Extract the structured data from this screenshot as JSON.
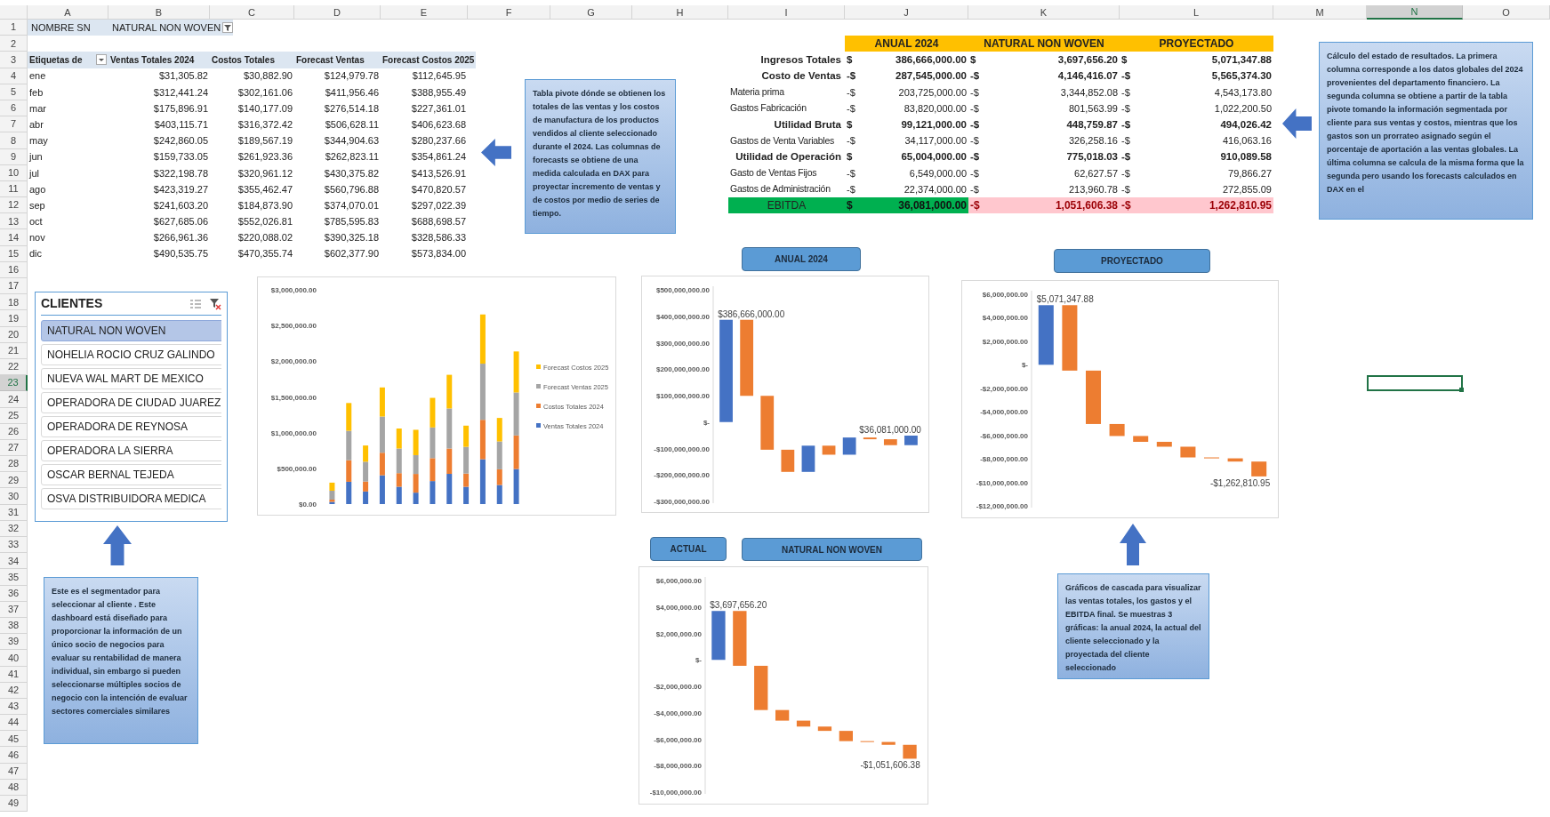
{
  "sheet": {
    "columns": [
      {
        "label": "A",
        "selected": false
      },
      {
        "label": "B",
        "selected": false
      },
      {
        "label": "C",
        "selected": false
      },
      {
        "label": "D",
        "selected": false
      },
      {
        "label": "E",
        "selected": false
      },
      {
        "label": "F",
        "selected": false
      },
      {
        "label": "G",
        "selected": false
      },
      {
        "label": "H",
        "selected": false
      },
      {
        "label": "I",
        "selected": false
      },
      {
        "label": "J",
        "selected": false
      },
      {
        "label": "K",
        "selected": false
      },
      {
        "label": "L",
        "selected": false
      },
      {
        "label": "M",
        "selected": false
      },
      {
        "label": "N",
        "selected": true
      },
      {
        "label": "O",
        "selected": false
      }
    ],
    "rows": [
      {
        "label": "1",
        "selected": false
      },
      {
        "label": "2",
        "selected": false
      },
      {
        "label": "3",
        "selected": false
      },
      {
        "label": "4",
        "selected": false
      },
      {
        "label": "5",
        "selected": false
      },
      {
        "label": "6",
        "selected": false
      },
      {
        "label": "7",
        "selected": false
      },
      {
        "label": "8",
        "selected": false
      },
      {
        "label": "9",
        "selected": false
      },
      {
        "label": "10",
        "selected": false
      },
      {
        "label": "11",
        "selected": false
      },
      {
        "label": "12",
        "selected": false
      },
      {
        "label": "13",
        "selected": false
      },
      {
        "label": "14",
        "selected": false
      },
      {
        "label": "15",
        "selected": false
      },
      {
        "label": "16",
        "selected": false
      },
      {
        "label": "17",
        "selected": false
      },
      {
        "label": "18",
        "selected": false
      },
      {
        "label": "19",
        "selected": false
      },
      {
        "label": "20",
        "selected": false
      },
      {
        "label": "21",
        "selected": false
      },
      {
        "label": "22",
        "selected": false
      },
      {
        "label": "23",
        "selected": true
      },
      {
        "label": "24",
        "selected": false
      },
      {
        "label": "25",
        "selected": false
      },
      {
        "label": "26",
        "selected": false
      },
      {
        "label": "27",
        "selected": false
      },
      {
        "label": "28",
        "selected": false
      },
      {
        "label": "29",
        "selected": false
      },
      {
        "label": "30",
        "selected": false
      },
      {
        "label": "31",
        "selected": false
      },
      {
        "label": "32",
        "selected": false
      },
      {
        "label": "33",
        "selected": false
      },
      {
        "label": "34",
        "selected": false
      },
      {
        "label": "35",
        "selected": false
      },
      {
        "label": "36",
        "selected": false
      },
      {
        "label": "37",
        "selected": false
      },
      {
        "label": "38",
        "selected": false
      },
      {
        "label": "39",
        "selected": false
      },
      {
        "label": "40",
        "selected": false
      },
      {
        "label": "41",
        "selected": false
      },
      {
        "label": "42",
        "selected": false
      },
      {
        "label": "43",
        "selected": false
      },
      {
        "label": "44",
        "selected": false
      },
      {
        "label": "45",
        "selected": false
      },
      {
        "label": "46",
        "selected": false
      },
      {
        "label": "47",
        "selected": false
      },
      {
        "label": "48",
        "selected": false
      },
      {
        "label": "49",
        "selected": false
      }
    ]
  },
  "filter": {
    "label": "NOMBRE SN",
    "value": "NATURAL NON WOVEN"
  },
  "pivot": {
    "columns": [
      "Etiquetas de",
      "Ventas Totales 2024",
      "Costos Totales",
      "Forecast Ventas",
      "Forecast Costos 2025"
    ],
    "rows": [
      {
        "label": "ene",
        "values": [
          "$31,305.82",
          "$30,882.90",
          "$124,979.78",
          "$112,645.95"
        ]
      },
      {
        "label": "feb",
        "values": [
          "$312,441.24",
          "$302,161.06",
          "$411,956.46",
          "$388,955.49"
        ]
      },
      {
        "label": "mar",
        "values": [
          "$175,896.91",
          "$140,177.09",
          "$276,514.18",
          "$227,361.01"
        ]
      },
      {
        "label": "abr",
        "values": [
          "$403,115.71",
          "$316,372.42",
          "$506,628.11",
          "$406,623.68"
        ]
      },
      {
        "label": "may",
        "values": [
          "$242,860.05",
          "$189,567.19",
          "$344,904.63",
          "$280,237.66"
        ]
      },
      {
        "label": "jun",
        "values": [
          "$159,733.05",
          "$261,923.36",
          "$262,823.11",
          "$354,861.24"
        ]
      },
      {
        "label": "jul",
        "values": [
          "$322,198.78",
          "$320,961.12",
          "$430,375.82",
          "$413,526.91"
        ]
      },
      {
        "label": "ago",
        "values": [
          "$423,319.27",
          "$355,462.47",
          "$560,796.88",
          "$470,820.57"
        ]
      },
      {
        "label": "sep",
        "values": [
          "$241,603.20",
          "$184,873.90",
          "$374,070.01",
          "$297,022.39"
        ]
      },
      {
        "label": "oct",
        "values": [
          "$627,685.06",
          "$552,026.81",
          "$785,595.83",
          "$688,698.57"
        ]
      },
      {
        "label": "nov",
        "values": [
          "$266,961.36",
          "$220,088.02",
          "$390,325.18",
          "$328,586.33"
        ]
      },
      {
        "label": "dic",
        "values": [
          "$490,535.75",
          "$470,355.74",
          "$602,377.90",
          "$573,834.00"
        ]
      }
    ]
  },
  "income_statement": {
    "columns": [
      "ANUAL 2024",
      "NATURAL NON WOVEN",
      "PROYECTADO"
    ],
    "rows": [
      {
        "label": "Ingresos Totales",
        "kind": "total",
        "values": [
          {
            "sign": "$",
            "amount": "386,666,000.00"
          },
          {
            "sign": "$",
            "amount": "3,697,656.20"
          },
          {
            "sign": "$",
            "amount": "5,071,347.88"
          }
        ]
      },
      {
        "label": "Costo de Ventas",
        "kind": "total",
        "values": [
          {
            "sign": "-$",
            "amount": "287,545,000.00"
          },
          {
            "sign": "-$",
            "amount": "4,146,416.07"
          },
          {
            "sign": "-$",
            "amount": "5,565,374.30"
          }
        ]
      },
      {
        "label": "Materia prima",
        "kind": "detail",
        "values": [
          {
            "sign": "-$",
            "amount": "203,725,000.00"
          },
          {
            "sign": "-$",
            "amount": "3,344,852.08"
          },
          {
            "sign": "-$",
            "amount": "4,543,173.80"
          }
        ]
      },
      {
        "label": "Gastos Fabricación",
        "kind": "detail",
        "values": [
          {
            "sign": "-$",
            "amount": "83,820,000.00"
          },
          {
            "sign": "-$",
            "amount": "801,563.99"
          },
          {
            "sign": "-$",
            "amount": "1,022,200.50"
          }
        ]
      },
      {
        "label": "Utilidad Bruta",
        "kind": "total",
        "values": [
          {
            "sign": "$",
            "amount": "99,121,000.00"
          },
          {
            "sign": "-$",
            "amount": "448,759.87"
          },
          {
            "sign": "-$",
            "amount": "494,026.42"
          }
        ]
      },
      {
        "label": "Gastos de Venta Variables",
        "kind": "detail",
        "values": [
          {
            "sign": "-$",
            "amount": "34,117,000.00"
          },
          {
            "sign": "-$",
            "amount": "326,258.16"
          },
          {
            "sign": "-$",
            "amount": "416,063.16"
          }
        ]
      },
      {
        "label": "Utilidad de Operación",
        "kind": "total",
        "values": [
          {
            "sign": "$",
            "amount": "65,004,000.00"
          },
          {
            "sign": "-$",
            "amount": "775,018.03"
          },
          {
            "sign": "-$",
            "amount": "910,089.58"
          }
        ]
      },
      {
        "label": "Gasto de Ventas Fijos",
        "kind": "detail",
        "values": [
          {
            "sign": "-$",
            "amount": "6,549,000.00"
          },
          {
            "sign": "-$",
            "amount": "62,627.57"
          },
          {
            "sign": "-$",
            "amount": "79,866.27"
          }
        ]
      },
      {
        "label": "Gastos de Administración",
        "kind": "detail",
        "values": [
          {
            "sign": "-$",
            "amount": "22,374,000.00"
          },
          {
            "sign": "-$",
            "amount": "213,960.78"
          },
          {
            "sign": "-$",
            "amount": "272,855.09"
          }
        ]
      },
      {
        "label": "EBITDA",
        "kind": "ebitda",
        "values": [
          {
            "sign": "$",
            "amount": "36,081,000.00",
            "positive": true
          },
          {
            "sign": "-$",
            "amount": "1,051,606.38",
            "positive": false
          },
          {
            "sign": "-$",
            "amount": "1,262,810.95",
            "positive": false
          }
        ]
      }
    ]
  },
  "pivot_note": "Tabla pivote dónde se obtienen los totales de las ventas y los costos de manufactura de los productos vendidos al cliente seleccionado durante el 2024. Las columnas de forecasts se obtiene de una medida calculada en DAX para proyectar incremento de ventas y de costos por medio de series de tiempo.",
  "income_note": "Cálculo del estado de resultados. La primera columna corresponde a los datos globales del 2024 provenientes del departamento financiero. La segunda columna se obtiene a partir de la tabla pivote tomando la información segmentada por cliente para sus ventas y costos, mientras que los gastos son un prorrateo asignado según el porcentaje de aportación a las ventas globales. La última columna se calcula de la misma forma que la segunda pero usando los forecasts calculados en DAX en el",
  "slicer": {
    "title": "CLIENTES",
    "items": [
      {
        "label": "NATURAL NON WOVEN",
        "selected": true
      },
      {
        "label": "NOHELIA ROCIO CRUZ GALINDO",
        "selected": false
      },
      {
        "label": "NUEVA WAL MART DE MEXICO",
        "selected": false
      },
      {
        "label": "OPERADORA DE CIUDAD JUAREZ",
        "selected": false
      },
      {
        "label": "OPERADORA DE REYNOSA",
        "selected": false
      },
      {
        "label": "OPERADORA LA SIERRA",
        "selected": false
      },
      {
        "label": "OSCAR BERNAL TEJEDA",
        "selected": false
      },
      {
        "label": "OSVA DISTRIBUIDORA MEDICA",
        "selected": false
      }
    ]
  },
  "slicer_note": "Este es el segmentador para seleccionar al cliente . Este dashboard está diseñado para proporcionar la información de un único socio de negocios para evaluar su rentabilidad de manera individual, sin embargo si pueden seleccionarse múltiples socios de negocio con la intención de evaluar sectores comerciales similares",
  "sales_chart": {
    "chart_data": {
      "type": "bar",
      "stacked": true,
      "legend": "right",
      "categories": [
        null,
        null,
        null,
        null,
        null,
        null,
        null,
        null,
        null,
        null,
        null,
        null
      ],
      "ylim": [
        0,
        3000000
      ],
      "yticks": [
        {
          "value": 0,
          "label": "$0.00"
        },
        {
          "value": 500000,
          "label": "$500,000.00"
        },
        {
          "value": 1000000,
          "label": "$1,000,000.00"
        },
        {
          "value": 1500000,
          "label": "$1,500,000.00"
        },
        {
          "value": 2000000,
          "label": "$2,000,000.00"
        },
        {
          "value": 2500000,
          "label": "$2,500,000.00"
        },
        {
          "value": 3000000,
          "label": "$3,000,000.00"
        }
      ],
      "series": [
        {
          "name": "Ventas Totales 2024",
          "color": "#4472c4",
          "values": [
            31000,
            312000,
            176000,
            403000,
            243000,
            160000,
            322000,
            423000,
            242000,
            628000,
            267000,
            491000
          ]
        },
        {
          "name": "Costos Totales 2024",
          "color": "#ed7d31",
          "values": [
            31000,
            302000,
            140000,
            316000,
            190000,
            262000,
            321000,
            355000,
            185000,
            552000,
            220000,
            470000
          ]
        },
        {
          "name": "Forecast Ventas 2025",
          "color": "#a5a5a5",
          "values": [
            125000,
            412000,
            277000,
            507000,
            345000,
            263000,
            430000,
            561000,
            374000,
            786000,
            390000,
            602000
          ]
        },
        {
          "name": "Forecast Costos 2025",
          "color": "#ffc000",
          "values": [
            113000,
            389000,
            227000,
            407000,
            280000,
            355000,
            414000,
            471000,
            297000,
            689000,
            329000,
            574000
          ]
        }
      ]
    }
  },
  "waterfalls": [
    {
      "buttons": [
        "ANUAL 2024"
      ],
      "axis_labels": [
        "$500,000,000.00",
        "$400,000,000.00",
        "$300,000,000.00",
        "$200,000,000.00",
        "$100,000,000.00",
        "$-",
        "-$100,000,000.00",
        "-$200,000,000.00",
        "-$300,000,000.00"
      ],
      "data_labels": [
        "$386,666,000.00",
        "$36,081,000.00"
      ]
    },
    {
      "buttons": [
        "ACTUAL",
        "NATURAL NON WOVEN"
      ],
      "axis_labels": [
        "$6,000,000.00",
        "$4,000,000.00",
        "$2,000,000.00",
        "$-",
        "-$2,000,000.00",
        "-$4,000,000.00",
        "-$6,000,000.00",
        "-$8,000,000.00",
        "-$10,000,000.00"
      ],
      "data_labels": [
        "$3,697,656.20",
        "-$1,051,606.38"
      ]
    },
    {
      "buttons": [
        "PROYECTADO"
      ],
      "axis_labels": [
        "$6,000,000.00",
        "$4,000,000.00",
        "$2,000,000.00",
        "$-",
        "-$2,000,000.00",
        "-$4,000,000.00",
        "-$6,000,000.00",
        "-$8,000,000.00",
        "-$10,000,000.00",
        "-$12,000,000.00"
      ],
      "data_labels": [
        "$5,071,347.88",
        "-$1,262,810.95"
      ]
    }
  ],
  "charts_note": "Gráficos de cascada para visualizar las ventas totales, los gastos y el EBITDA final. Se muestras 3 gráficas: la anual 2024, la actual del cliente seleccionado y la proyectada del cliente seleccionado"
}
